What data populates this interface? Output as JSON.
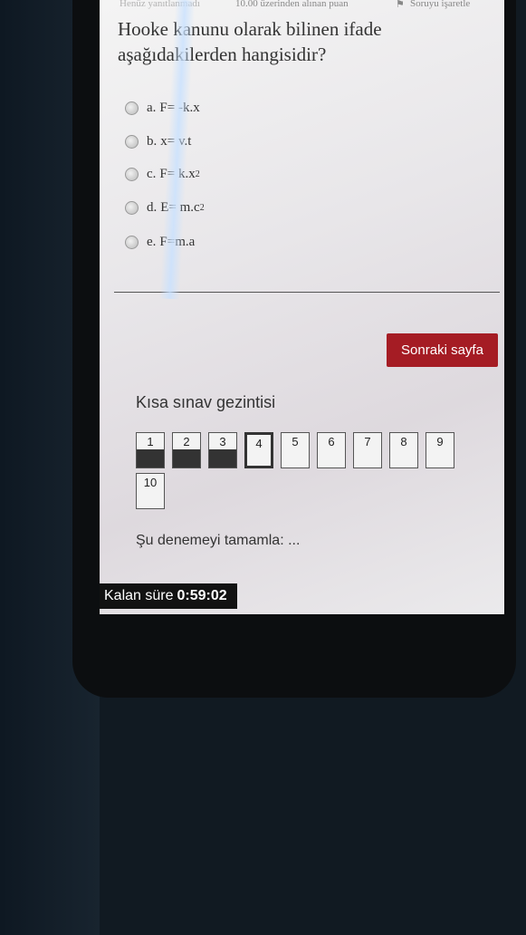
{
  "topbar": {
    "status_partial": "Henüz yanıtlanmadı",
    "points": "10.00 üzerinden alınan puan",
    "flag_label": "Soruyu işaretle",
    "flag_icon": "flag-icon"
  },
  "question": {
    "text": "Hooke kanunu olarak bilinen ifade aşağıdakilerden hangisidir?",
    "options": [
      {
        "letter": "a.",
        "text": "F= -k.x"
      },
      {
        "letter": "b.",
        "text": "x= v.t"
      },
      {
        "letter": "c.",
        "text": "F= k.x",
        "sup": "2"
      },
      {
        "letter": "d.",
        "text": "E= m.c",
        "sup": "2"
      },
      {
        "letter": "e.",
        "text": "F=m.a"
      }
    ]
  },
  "next_button": "Sonraki sayfa",
  "quiz_nav": {
    "title": "Kısa sınav gezintisi",
    "items": [
      {
        "num": "1",
        "state": "answered"
      },
      {
        "num": "2",
        "state": "answered"
      },
      {
        "num": "3",
        "state": "answered"
      },
      {
        "num": "4",
        "state": "current"
      },
      {
        "num": "5",
        "state": "empty"
      },
      {
        "num": "6",
        "state": "empty"
      },
      {
        "num": "7",
        "state": "empty"
      },
      {
        "num": "8",
        "state": "empty"
      },
      {
        "num": "9",
        "state": "empty"
      },
      {
        "num": "10",
        "state": "empty"
      }
    ],
    "finish_link": "Şu denemeyi tamamla: ..."
  },
  "timer": {
    "label": "Kalan süre",
    "value": "0:59:02"
  },
  "colors": {
    "accent": "#a51c24",
    "timer_bg": "#121212"
  }
}
